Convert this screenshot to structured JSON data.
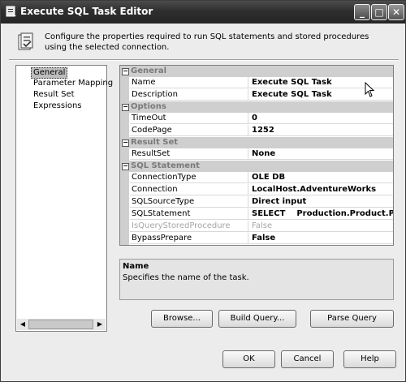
{
  "window": {
    "title": "Execute SQL Task Editor"
  },
  "titlebar_buttons": {
    "minimize": "_",
    "maximize": "□",
    "close": "✕"
  },
  "header": {
    "description": "Configure the properties required to run SQL statements and stored procedures using the selected connection."
  },
  "nav": {
    "items": [
      {
        "label": "General",
        "selected": true
      },
      {
        "label": "Parameter Mapping"
      },
      {
        "label": "Result Set"
      },
      {
        "label": "Expressions"
      }
    ]
  },
  "grid": {
    "cat_general": "General",
    "name_label": "Name",
    "name_value": "Execute SQL Task",
    "desc_label": "Description",
    "desc_value": "Execute SQL Task",
    "cat_options": "Options",
    "timeout_label": "TimeOut",
    "timeout_value": "0",
    "codepage_label": "CodePage",
    "codepage_value": "1252",
    "cat_resultset": "Result Set",
    "resultset_label": "ResultSet",
    "resultset_value": "None",
    "cat_sql": "SQL Statement",
    "conntype_label": "ConnectionType",
    "conntype_value": "OLE DB",
    "conn_label": "Connection",
    "conn_value": "LocalHost.AdventureWorks",
    "srctype_label": "SQLSourceType",
    "srctype_value": "Direct input",
    "stmt_label": "SQLStatement",
    "stmt_value": "SELECT    Production.Product.Product",
    "isproc_label": "IsQueryStoredProcedure",
    "isproc_value": "False",
    "bypass_label": "BypassPrepare",
    "bypass_value": "False"
  },
  "description_panel": {
    "title": "Name",
    "text": "Specifies the name of the task."
  },
  "buttons": {
    "browse": "Browse...",
    "build_query": "Build Query...",
    "parse_query": "Parse Query",
    "ok": "OK",
    "cancel": "Cancel",
    "help": "Help"
  }
}
